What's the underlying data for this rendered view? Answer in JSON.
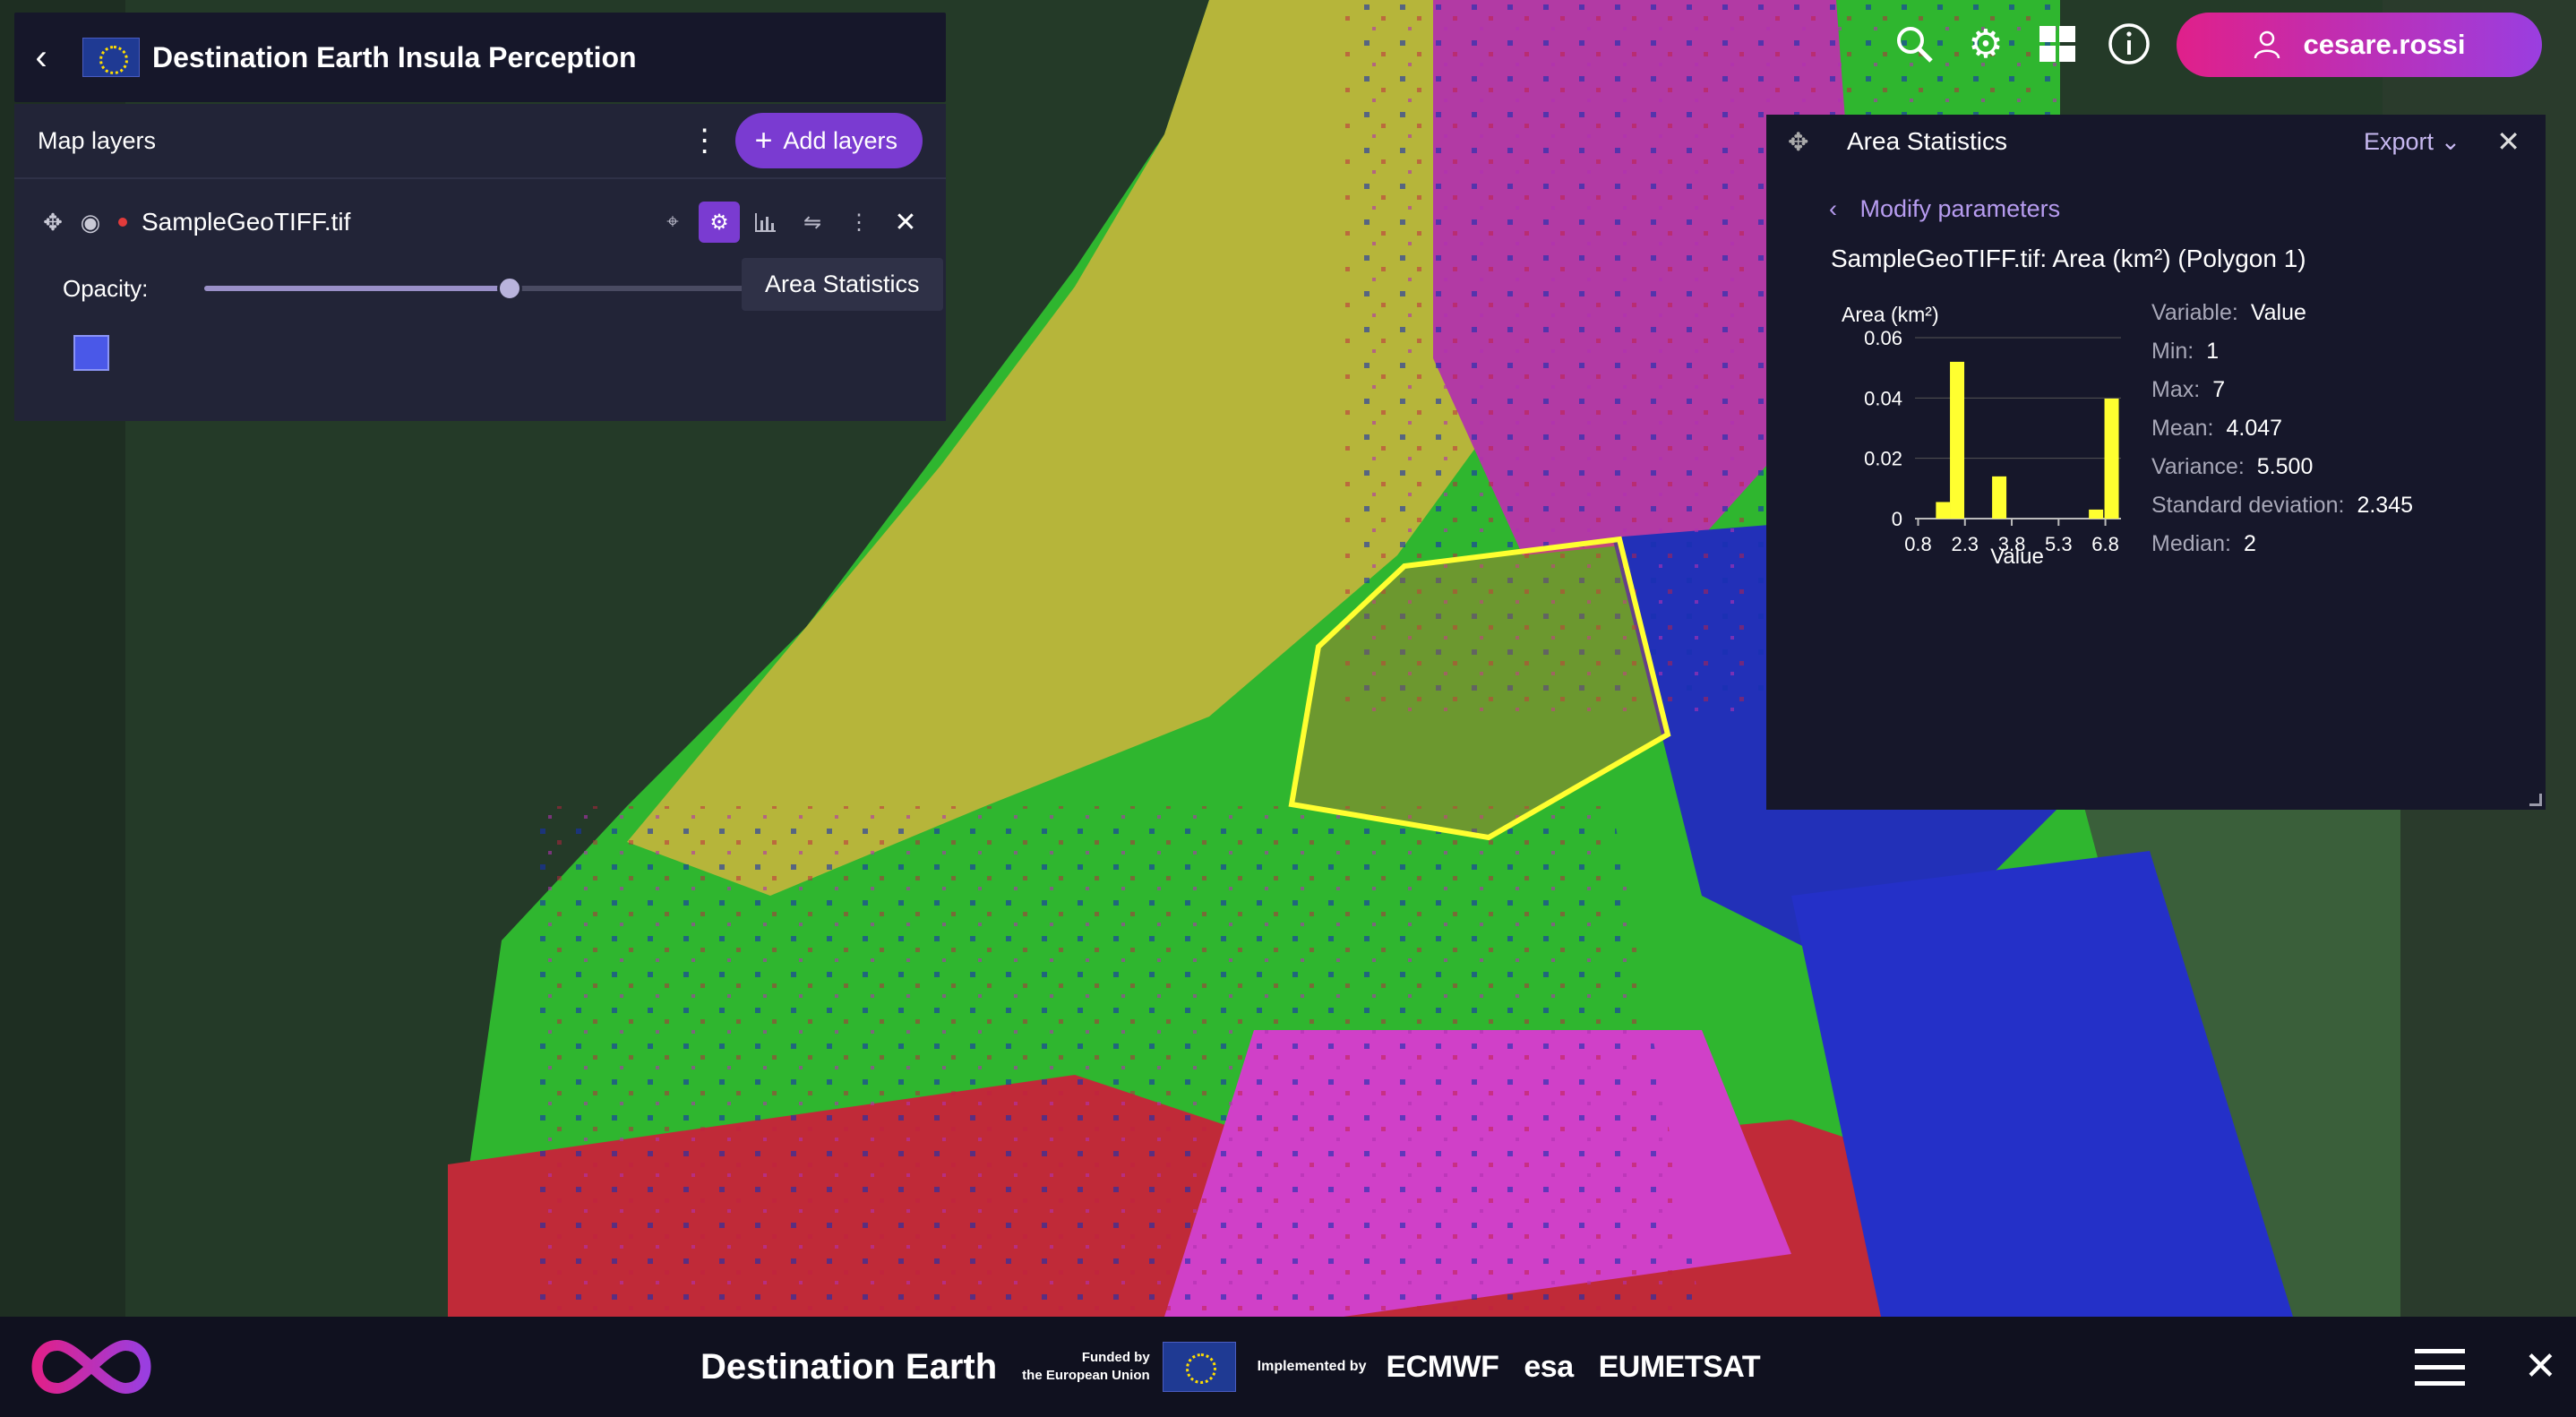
{
  "app": {
    "title": "Destination Earth Insula Perception"
  },
  "layers_panel": {
    "title": "Map layers",
    "add_label": "Add layers",
    "layer": {
      "name": "SampleGeoTIFF.tif",
      "opacity_label": "Opacity:",
      "opacity": 0.55
    },
    "tooltip": "Area Statistics"
  },
  "user": {
    "name": "cesare.rossi"
  },
  "stats_panel": {
    "title": "Area Statistics",
    "export_label": "Export",
    "modify_label": "Modify parameters",
    "subtitle": "SampleGeoTIFF.tif: Area (km²) (Polygon 1)",
    "stats": [
      {
        "key": "Variable",
        "value": "Value"
      },
      {
        "key": "Min",
        "value": "1"
      },
      {
        "key": "Max",
        "value": "7"
      },
      {
        "key": "Mean",
        "value": "4.047"
      },
      {
        "key": "Variance",
        "value": "5.500"
      },
      {
        "key": "Standard deviation",
        "value": "2.345"
      },
      {
        "key": "Median",
        "value": "2"
      }
    ]
  },
  "chart_data": {
    "type": "bar",
    "ylabel": "Area (km²)",
    "xlabel": "Value",
    "ylim": [
      0,
      0.06
    ],
    "yticks": [
      0,
      0.02,
      0.04,
      0.06
    ],
    "ytick_labels": [
      "0",
      "0.02",
      "0.04",
      "0.06"
    ],
    "xlim": [
      0.7,
      7.3
    ],
    "xticks": [
      0.8,
      2.3,
      3.8,
      5.3,
      6.8
    ],
    "xtick_labels": [
      "0.8",
      "2.3",
      "3.8",
      "5.3",
      "6.8"
    ],
    "x": [
      1.6,
      2.05,
      3.4,
      6.5,
      7.0
    ],
    "values": [
      0.0055,
      0.052,
      0.014,
      0.003,
      0.0398
    ],
    "bar_color": "#ffff30",
    "grid": true
  },
  "footer": {
    "brand": "Destination Earth",
    "funded_line1": "Funded by",
    "funded_line2": "the European Union",
    "implemented": "Implemented by",
    "partners": [
      "ECMWF",
      "esa",
      "EUMETSAT"
    ]
  },
  "colors": {
    "accent": "#7a3bd1",
    "user_gradient_start": "#e0208a",
    "user_gradient_end": "#9a3ee0",
    "polygon": "#ffff30"
  }
}
